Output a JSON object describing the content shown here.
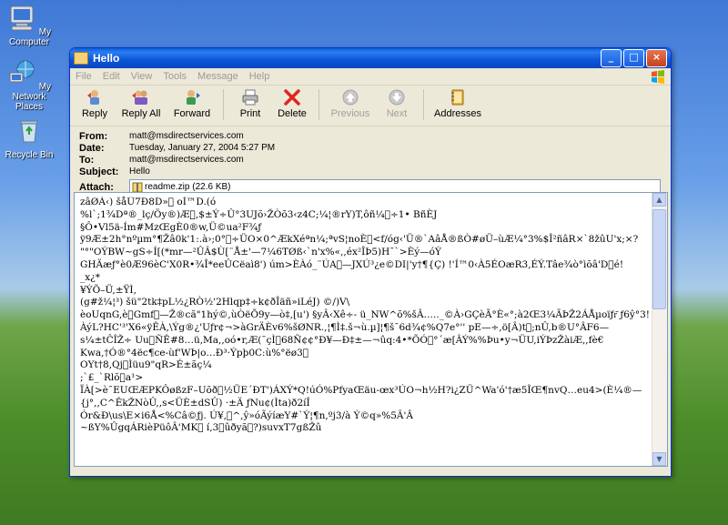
{
  "desktop": {
    "icons": [
      {
        "label": "My Computer"
      },
      {
        "label": "My Network Places"
      },
      {
        "label": "Recycle Bin"
      }
    ]
  },
  "window": {
    "title": "Hello",
    "controls": {
      "minimize": "_",
      "maximize": "□",
      "close": "×"
    }
  },
  "menu": [
    "File",
    "Edit",
    "View",
    "Tools",
    "Message",
    "Help"
  ],
  "toolbar": {
    "reply": "Reply",
    "reply_all": "Reply All",
    "forward": "Forward",
    "print": "Print",
    "delete": "Delete",
    "previous": "Previous",
    "next": "Next",
    "addresses": "Addresses"
  },
  "headers": {
    "from_label": "From:",
    "from": "matt@msdirectservices.com",
    "date_label": "Date:",
    "date": "Tuesday, January 27, 2004 5:27 PM",
    "to_label": "To:",
    "to": "matt@msdirectservices.com",
    "subject_label": "Subject:",
    "subject": "Hello",
    "attach_label": "Attach:",
    "attachment": "readme.zip (22.6 KB)"
  },
  "message": {
    "body": "zâØÀ‹) šåÛ7Ð8D»\u0000 oÍ™D.(ó\n%l`;1¾Dª®_lç/Öy®)Æ\u0000,$±Ý÷Û°3UJõ›ŽÒõ3‹z4C;¼¦®rY)T,ôñ¼\u0000÷1• BñÈJ\n§Ô•Vl5ä-Ím#MzŒgÈ0®w,Ü©ua²F¾ƒ\nÿ9Æ±2h°nºµm°¶Žâ0k'1:.à›;0°\u0000÷ÜO×0^ÆkXéªn¼;ªvS¦noÈ\u0000<f/óg‹'Ü®`AâÅ®ßÒ#øÜ–ùÆ¼°3%$Î²ñâR×`8žûU'x;×?\n\"°\"OÝBW~gS÷Í[(*mr—²ÛÂ$Ù[¨Å±'—7¼6TØß‹`n'x%«,,éx²ÎÞ5)H¯`>Èý—óÝ\nGHÄæƒ°è0Æ96èC'X0R•¾Î*eeÛCëaì8') úm>ÈÀó_¨ÚA\u0000—JXÚ³¿e©DI|'y†¶{Ç) !'Í™0‹À5ÉOæR3,ÉÝ.Tâe¾ò°ìõâ'D\u0000é!\n_x¿*\n¥ÝÕ–Ü,±ŸÌ,\n(g#ž¼¦³) šü\"2tk‡pL½¿RÒ½'2Hlqp‡÷k¢ðÎäñ»iLéJ) ©/)V\\\nèoUqnG,è\u0000Gmf\u0000—Ž®că\"1hý©,ùÒëÕ9y—ò‡,[u') §yÂ‹Xê÷- ü_NW^õ%šÂ….._©À›GÇèÃ°È«°;à2Œ3¼ÃÞŽ2ÁÅµoïƒr͂ ƒ6ŷ°3!\nÀýL?HC'³'X6«ÿÊÀ,\\Ýg®¿'Uƒr¢¬>àGrÄÈv6%šØNR.,¦¶Ì‡.š¬ù.µ]¦¶š¯6d¾¢%Q7e°'' pE—÷,ö[Â)t\u0000;nÛ,b®U°ÂF6—\ns¼±tĈÎŽ÷ Uu\u0000ÑÊ#8…ü,Ma,,oó•r,Æ(¯çÌ\u000068Ñ¢¢°Ð¥—Ð‡±—¬ûq:4•*ÕÓ\u0000°´æ[ÂÝ%%Þu•y¬ÜU,iÝÞzŽàiÆ,,fè€\nKwa,†Ó®°4ëc¶ce-ùf'WÞ|o…Ð³·Ýpþ0C:ù%°ëø3\u0000\nOYt†8,Qj\u0000Ìüu9\"qR>É±ãç¼\n;`£_`Rlŏ\u0000a¹>\nÏÀ[>è¯EUŒÆPKÔøßzF–Uõð\u0000½ÜE´ÐT')ÁXÝ*Q!úÓ%PfyaŒäu-œx³ÚO¬h½H?i¿ZÜ^Wa'ó'†æ5ÎŒ¶nvQ…eu4>(È¼®—\n{j°,,C^ÊkŽNòÛ,,s<ÜÈ±dSÛ) ·±Ä ƒNu¢(Ìta)ð2íÎ\nÓr&Ð\\us\\E×i6Å<%Câ©ƒj. Ú¥,\u0000^,ŷ»óÃýíæY#`Ý¦¶n,ºj3/à Ý©q»%5Â'Â\n~ßY%ÛgqÁRièPüôÂ'MK\u0000 í,3\u0000ûðyã\u0000?)suvxT7gßŽû"
  }
}
